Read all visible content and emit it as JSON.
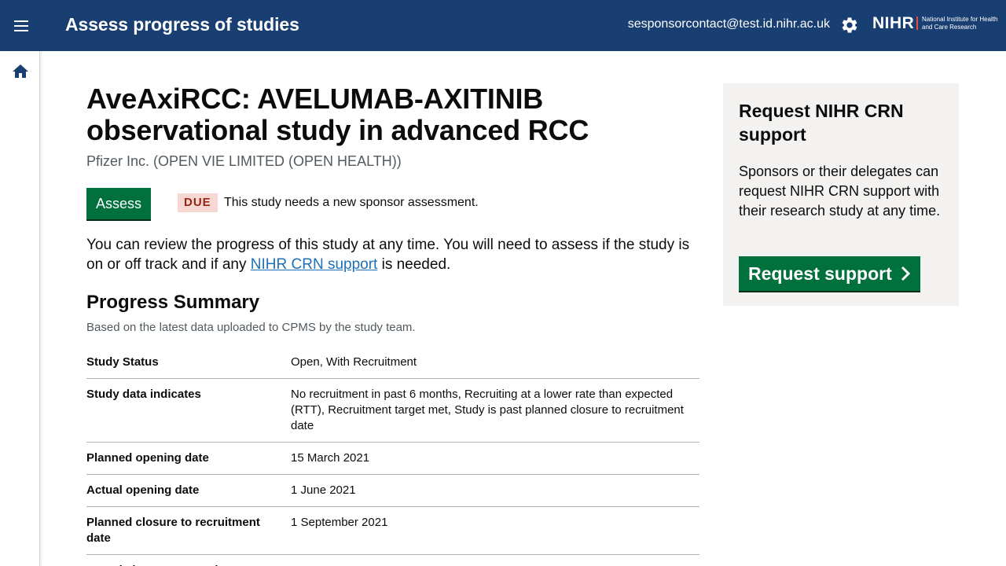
{
  "header": {
    "title": "Assess progress of studies",
    "user_email": "sesponsorcontact@test.id.nihr.ac.uk",
    "brand": "NIHR",
    "brand_sub": "National Institute for Health and Care Research"
  },
  "study": {
    "title": "AveAxiRCC: AVELUMAB-AXITINIB observational study in advanced RCC",
    "sponsor": "Pfizer Inc. (OPEN VIE LIMITED (OPEN HEALTH))",
    "assess_label": "Assess",
    "due_tag": "DUE",
    "due_text": "This study needs a new sponsor assessment.",
    "intro_before": "You can review the progress of this study at any time. You will need to assess if the study is on or off track and if any ",
    "intro_link": "NIHR CRN support",
    "intro_after": " is needed."
  },
  "progress": {
    "heading": "Progress Summary",
    "caption": "Based on the latest data uploaded to CPMS by the study team.",
    "rows": [
      {
        "key": "Study Status",
        "value": "Open, With Recruitment"
      },
      {
        "key": "Study data indicates",
        "value": "No recruitment in past 6 months, Recruiting at a lower rate than expected (RTT), Recruitment target met, Study is past planned closure to recruitment date"
      },
      {
        "key": "Planned opening date",
        "value": "15 March 2021"
      },
      {
        "key": "Actual opening date",
        "value": "1 June 2021"
      },
      {
        "key": "Planned closure to recruitment date",
        "value": "1 September 2021"
      },
      {
        "key": "Actual closure to recruitment",
        "value": ""
      }
    ]
  },
  "aside": {
    "title": "Request NIHR CRN support",
    "text": "Sponsors or their delegates can request NIHR CRN support with their research study at any time.",
    "button": "Request support"
  },
  "icons": {
    "menu": "menu-icon",
    "settings": "gear-icon",
    "home": "home-icon",
    "chevron": "chevron-right-icon"
  },
  "colors": {
    "header_bg": "#193e72",
    "primary_button": "#00703c",
    "due_tag_bg": "#f6d7d2",
    "due_tag_text": "#942514",
    "link": "#1d70b8",
    "aside_bg": "#f3f2f1"
  }
}
